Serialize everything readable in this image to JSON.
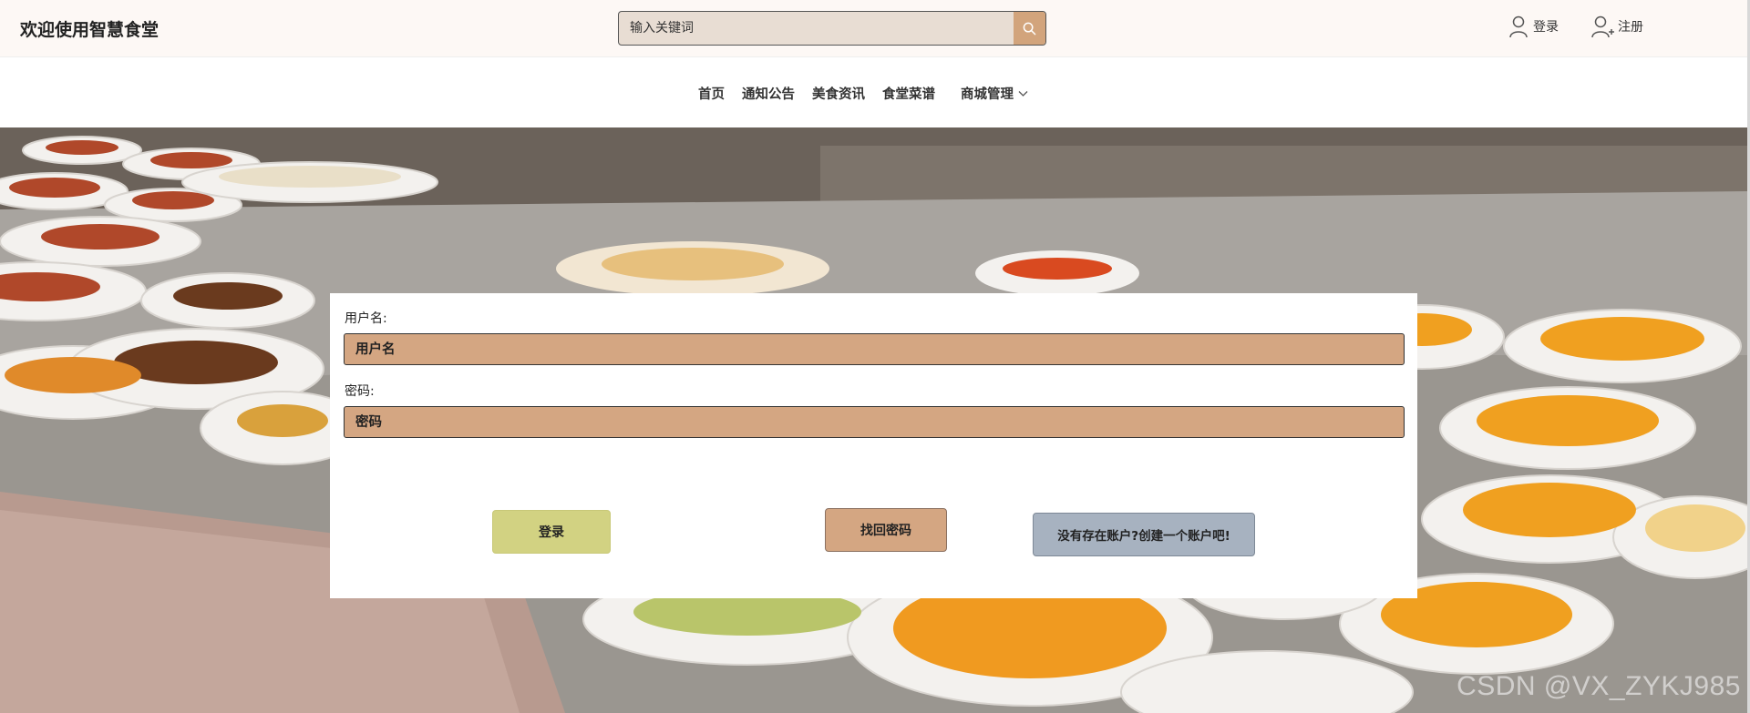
{
  "header": {
    "site_title": "欢迎使用智慧食堂",
    "search_placeholder": "输入关键词",
    "login_label": "登录",
    "register_label": "注册"
  },
  "nav": {
    "items": [
      "首页",
      "通知公告",
      "美食资讯",
      "食堂菜谱"
    ],
    "dropdown_label": "商城管理"
  },
  "login_form": {
    "username_label": "用户名:",
    "username_placeholder": "用户名",
    "password_label": "密码:",
    "password_placeholder": "密码",
    "login_button": "登录",
    "forgot_button": "找回密码",
    "create_button": "没有存在账户?创建一个账户吧!"
  },
  "watermark": "CSDN @VX_ZYKJ985",
  "colors": {
    "input_bg": "#d4a682",
    "login_btn": "#d2d282",
    "create_btn": "#a7b2c0",
    "search_btn": "#d2a47c"
  }
}
